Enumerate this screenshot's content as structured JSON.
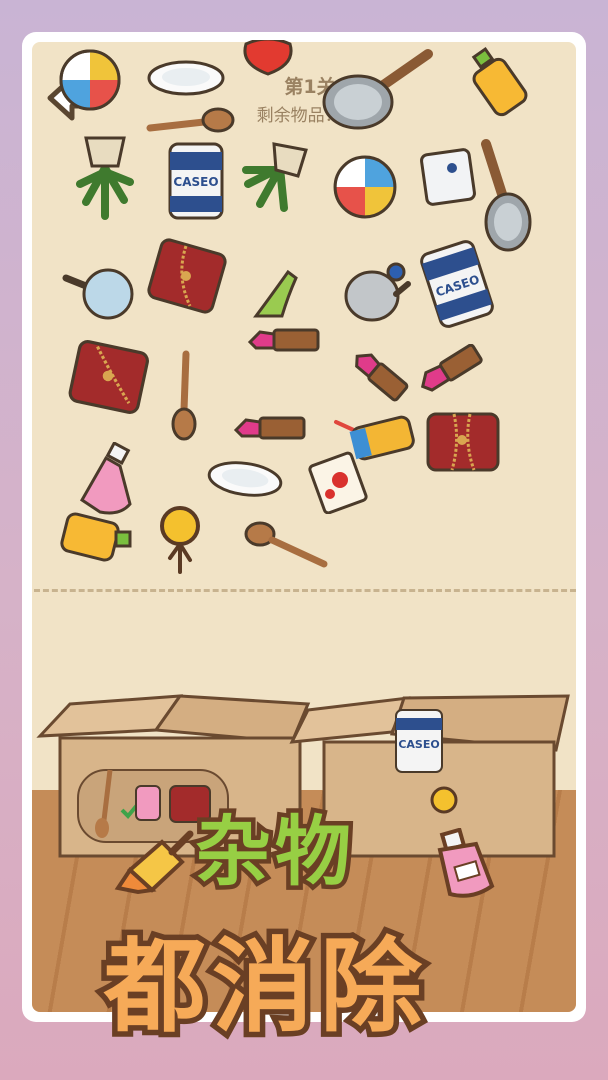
{
  "hud": {
    "level_title": "第1关",
    "remaining_label": "剩余物品：17"
  },
  "headline": {
    "line1": "杂物",
    "line2": "都消除"
  },
  "can_label": "CASEO",
  "colors": {
    "headline_green": "#97cf44",
    "headline_orange": "#f6aa58",
    "outline_brown": "#6a3f24",
    "board_bg": "#f1e3c6",
    "box_cardboard": "#d8b58a"
  },
  "icons": [
    "back-arrow-icon",
    "beach-ball-icon",
    "plate-icon",
    "apple-icon",
    "frying-pan-icon",
    "juice-bottle-icon",
    "wooden-spoon-icon",
    "potted-plant-icon",
    "tin-can-icon",
    "milk-carton-icon",
    "magnifier-icon",
    "leather-pouch-icon",
    "high-heel-icon",
    "teapot-icon",
    "lipstick-icon",
    "bubble-tea-icon",
    "perfume-bottle-icon",
    "pocket-watch-icon",
    "flower-card-icon",
    "paintbrush-icon"
  ]
}
